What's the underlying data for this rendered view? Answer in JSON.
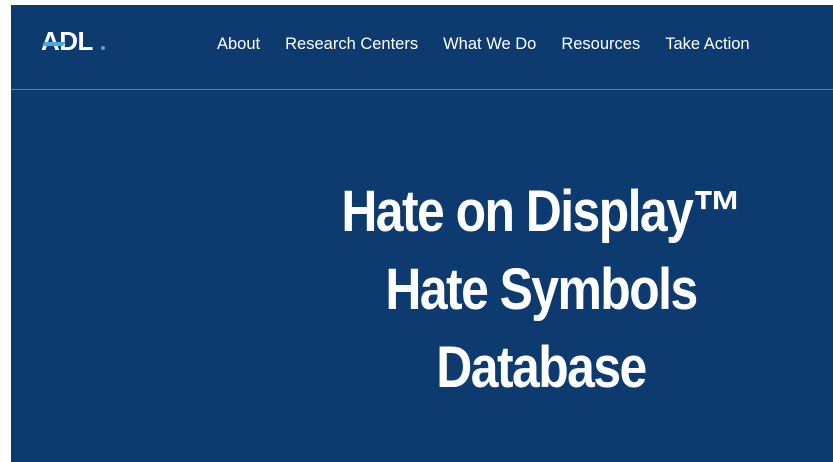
{
  "header": {
    "logo_text": "ADL",
    "nav": [
      {
        "label": "About"
      },
      {
        "label": "Research Centers"
      },
      {
        "label": "What We Do"
      },
      {
        "label": "Resources"
      },
      {
        "label": "Take Action"
      }
    ]
  },
  "hero": {
    "title_lines": [
      "Hate on Display™",
      "Hate Symbols",
      "Database"
    ]
  },
  "colors": {
    "background": "#0d3a6f",
    "text": "#ffffff",
    "logo_accent": "#4aa6e8"
  }
}
